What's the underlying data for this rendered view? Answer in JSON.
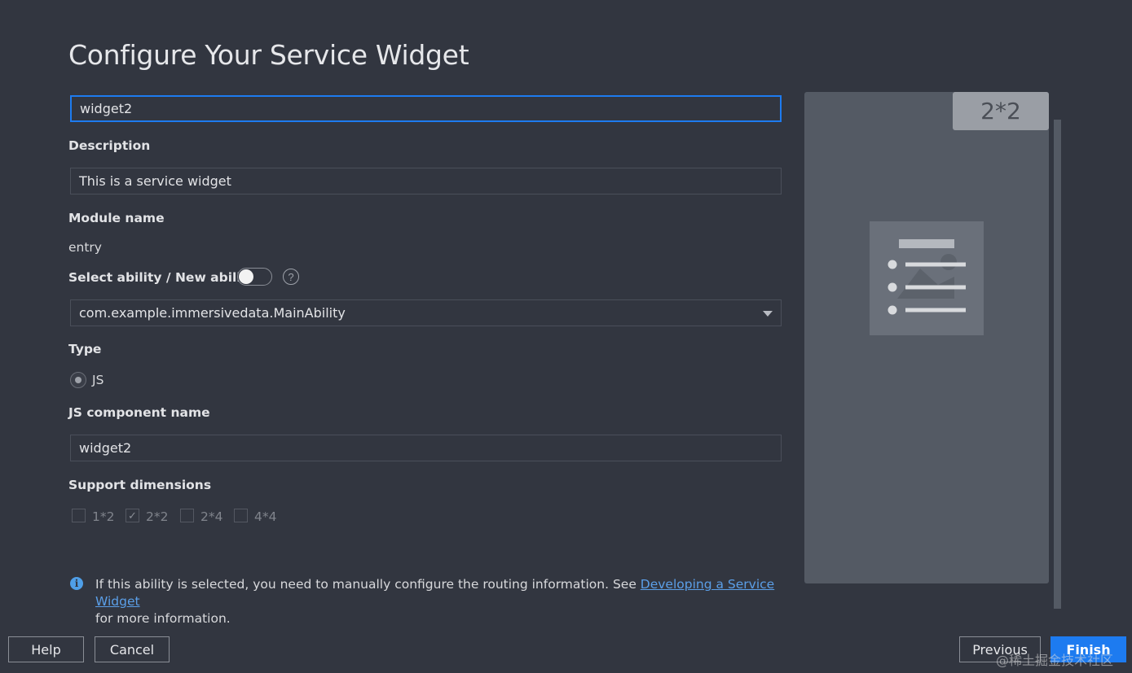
{
  "dialog": {
    "title": "Configure Your Service Widget"
  },
  "form": {
    "name_value": "widget2",
    "description_label": "Description",
    "description_value": "This is a service widget",
    "module_label": "Module name",
    "module_value": "entry",
    "ability_label": "Select ability / New ability",
    "ability_toggle_on": false,
    "help_glyph": "?",
    "ability_value": "com.example.immersivedata.MainAbility",
    "type_label": "Type",
    "type_option": "JS",
    "js_component_label": "JS component name",
    "js_component_value": "widget2",
    "dimensions_label": "Support dimensions",
    "dimensions": [
      {
        "label": "1*2",
        "checked": false
      },
      {
        "label": "2*2",
        "checked": true
      },
      {
        "label": "2*4",
        "checked": false
      },
      {
        "label": "4*4",
        "checked": false
      }
    ]
  },
  "info": {
    "icon": "info-icon",
    "text_before": "If this ability is selected, you need to manually configure the routing information. See ",
    "link_text": "Developing a Service Widget",
    "text_after": " for more information."
  },
  "preview": {
    "size_badge": "2*2"
  },
  "buttons": {
    "help": "Help",
    "cancel": "Cancel",
    "previous": "Previous",
    "finish": "Finish"
  },
  "watermark": "@稀土掘金技术社区",
  "colors": {
    "accent": "#1d7bf0",
    "background": "#323640",
    "link": "#5b9fe8"
  }
}
